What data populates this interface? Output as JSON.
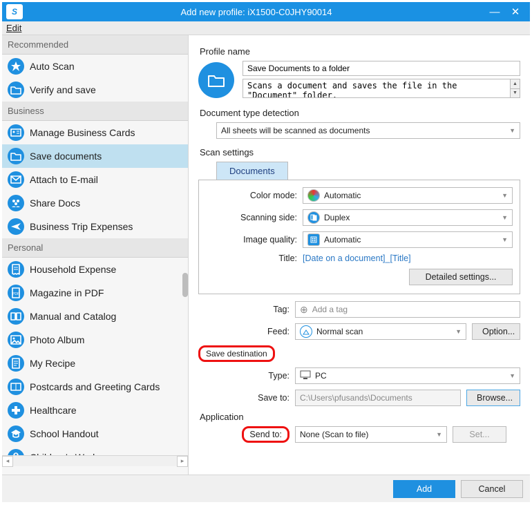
{
  "window": {
    "title": "Add new profile: iX1500-C0JHY90014",
    "logo_text": "S",
    "edit_key": "E",
    "edit_label": "dit"
  },
  "sidebar": {
    "groups": [
      {
        "label": "Recommended",
        "items": [
          {
            "icon": "star",
            "label": "Auto Scan"
          },
          {
            "icon": "folder",
            "label": "Verify and save"
          }
        ]
      },
      {
        "label": "Business",
        "items": [
          {
            "icon": "card",
            "label": "Manage Business Cards"
          },
          {
            "icon": "folder",
            "label": "Save documents",
            "selected": true
          },
          {
            "icon": "mail",
            "label": "Attach to E-mail"
          },
          {
            "icon": "people",
            "label": "Share Docs"
          },
          {
            "icon": "plane",
            "label": "Business Trip Expenses"
          }
        ]
      },
      {
        "label": "Personal",
        "items": [
          {
            "icon": "receipt",
            "label": "Household Expense"
          },
          {
            "icon": "pdf",
            "label": "Magazine in PDF"
          },
          {
            "icon": "book",
            "label": "Manual and Catalog"
          },
          {
            "icon": "photo",
            "label": "Photo Album"
          },
          {
            "icon": "recipe",
            "label": "My Recipe"
          },
          {
            "icon": "postcard",
            "label": "Postcards and Greeting Cards"
          },
          {
            "icon": "health",
            "label": "Healthcare"
          },
          {
            "icon": "school",
            "label": "School Handout"
          },
          {
            "icon": "child",
            "label": "Children's Works"
          }
        ]
      }
    ]
  },
  "profile": {
    "section_label": "Profile name",
    "name": "Save Documents to a folder",
    "description": "Scans a document and saves the file in the \"Document\" folder."
  },
  "doc_detection": {
    "section_label": "Document type detection",
    "value": "All sheets will be scanned as documents"
  },
  "scan": {
    "section_label": "Scan settings",
    "tab": "Documents",
    "color_mode": {
      "label": "Color mode:",
      "value": "Automatic"
    },
    "scanning_side": {
      "label": "Scanning side:",
      "value": "Duplex"
    },
    "image_quality": {
      "label": "Image quality:",
      "value": "Automatic"
    },
    "title": {
      "label": "Title:",
      "value": "[Date on a document]_[Title]"
    },
    "detailed_btn": "Detailed settings...",
    "tag": {
      "label": "Tag:",
      "placeholder": "Add a tag"
    },
    "feed": {
      "label": "Feed:",
      "value": "Normal scan",
      "option_btn": "Option..."
    }
  },
  "save": {
    "section_label": "Save destination",
    "type": {
      "label": "Type:",
      "value": "PC"
    },
    "save_to": {
      "label": "Save to:",
      "value": "C:\\Users\\pfusands\\Documents",
      "browse_btn": "Browse..."
    }
  },
  "application": {
    "section_label": "Application",
    "send_to": {
      "label": "Send to:",
      "value": "None (Scan to file)",
      "set_btn": "Set..."
    }
  },
  "footer": {
    "add": "Add",
    "cancel": "Cancel"
  }
}
